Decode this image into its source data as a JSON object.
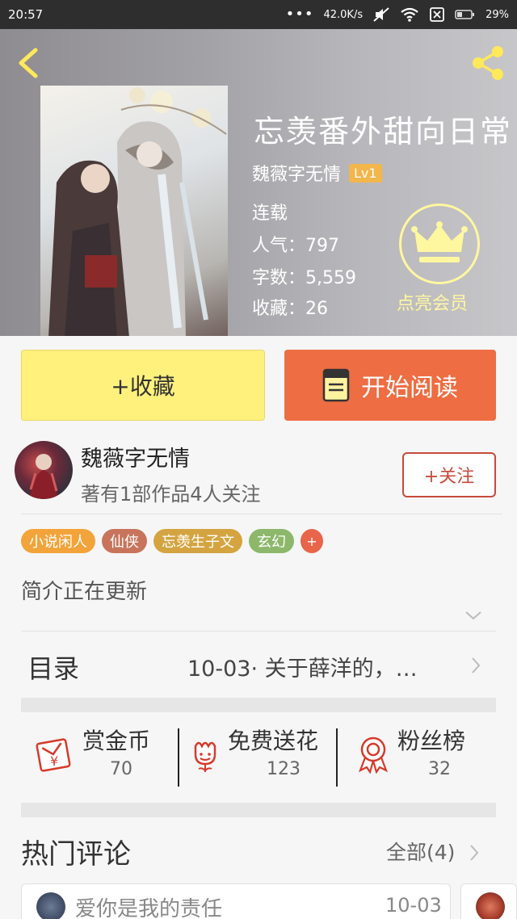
{
  "statusbar": {
    "time": "20:57",
    "dots": "•••",
    "network_speed": "42.0K/s",
    "battery": "29%"
  },
  "header": {
    "back_icon": "chevron-left-icon",
    "share_icon": "share-icon"
  },
  "book": {
    "title": "忘羡番外甜向日常",
    "author": "魏薇字无情",
    "author_level": "Lv1",
    "status": "连载",
    "popularity": "人气：797",
    "word_count": "字数：5,559",
    "favorites": "收藏：26"
  },
  "vip": {
    "label": "点亮会员",
    "color": "#fff7a0"
  },
  "actions": {
    "favorite_label": "+收藏",
    "read_label": "开始阅读"
  },
  "author_card": {
    "name": "魏薇字无情",
    "subtitle": "著有1部作品4人关注",
    "follow_label": "+关注"
  },
  "tags": [
    {
      "label": "小说闲人",
      "color": "#f2a43a"
    },
    {
      "label": "仙侠",
      "color": "#c8745c"
    },
    {
      "label": "忘羡生子文",
      "color": "#d4a441"
    },
    {
      "label": "玄幻",
      "color": "#8db86b"
    },
    {
      "label": "+",
      "color": "#e8654a"
    }
  ],
  "intro": {
    "text": "简介正在更新"
  },
  "catalog": {
    "label": "目录",
    "latest": "10-03· 关于薛洋的，…"
  },
  "stats": [
    {
      "label": "赏金币",
      "value": "70",
      "icon": "red-envelope-icon"
    },
    {
      "label": "免费送花",
      "value": "123",
      "icon": "flower-icon"
    },
    {
      "label": "粉丝榜",
      "value": "32",
      "icon": "medal-icon"
    }
  ],
  "comments": {
    "title": "热门评论",
    "all_label": "全部(4)",
    "items": [
      {
        "text": "爱你是我的责任",
        "date": "10-03"
      }
    ]
  }
}
